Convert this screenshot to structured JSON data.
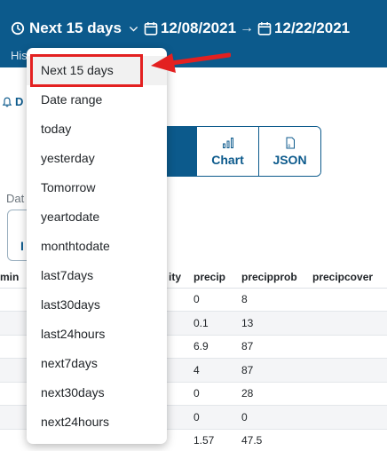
{
  "header": {
    "period_label": "Next 15 days",
    "start_date": "12/08/2021",
    "arrow": "→",
    "end_date": "12/22/2021",
    "subtab_partial": "His"
  },
  "page": {
    "alerts_partial": "D",
    "view_buttons": [
      "Chart",
      "JSON"
    ],
    "data_label_partial": "Dat",
    "data_box_partial": "I"
  },
  "dropdown": {
    "options": [
      "Next 15 days",
      "Date range",
      "today",
      "yesterday",
      "Tomorrow",
      "yeartodate",
      "monthtodate",
      "last7days",
      "last30days",
      "last24hours",
      "next7days",
      "next30days",
      "next24hours"
    ],
    "selected_index": 0
  },
  "table": {
    "headers": [
      "min",
      "",
      "",
      "ity",
      "precip",
      "precipprob",
      "precipcover"
    ],
    "rows": [
      [
        "",
        "",
        "",
        "",
        "0",
        "8",
        ""
      ],
      [
        "",
        "",
        "",
        "",
        "0.1",
        "13",
        ""
      ],
      [
        "",
        "",
        "",
        "",
        "6.9",
        "87",
        ""
      ],
      [
        "",
        "",
        "",
        "",
        "4",
        "87",
        ""
      ],
      [
        "",
        "",
        "",
        "",
        "0",
        "28",
        ""
      ],
      [
        "",
        "",
        "",
        "",
        "0",
        "0",
        ""
      ],
      [
        "",
        "",
        "",
        "",
        "1.57",
        "47.5",
        ""
      ]
    ]
  },
  "colors": {
    "brand": "#0c5a8c",
    "annotation": "#e32020"
  },
  "icons": {
    "period": "clock-icon",
    "dates": "calendar-icon",
    "bell": "bell-icon",
    "chart": "bar-chart-icon",
    "json": "json-file-icon"
  }
}
